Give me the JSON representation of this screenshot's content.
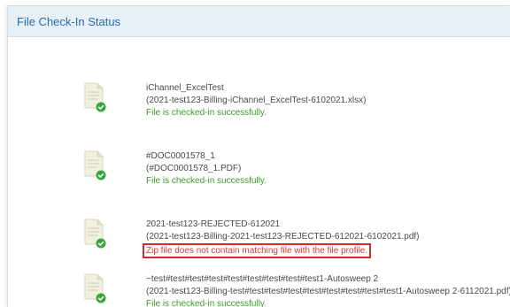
{
  "header": {
    "title": "File Check-In Status"
  },
  "colors": {
    "header_bg": "#e7f0f6",
    "title": "#2a6cab",
    "success": "#3a9a2a",
    "error": "#d63838",
    "highlight_border": "#d52b2b"
  },
  "files": [
    {
      "name": "iChannel_ExcelTest",
      "path": "(2021-test123-Billing-iChannel_ExcelTest-6102021.xlsx)",
      "status": "File is checked-in successfully.",
      "status_type": "success",
      "icon": "document-check-icon"
    },
    {
      "name": "#DOC0001578_1",
      "path": "(#DOC0001578_1.PDF)",
      "status": "File is checked-in successfully.",
      "status_type": "success",
      "icon": "document-check-icon"
    },
    {
      "name": "2021-test123-REJECTED-612021",
      "path": "(2021-test123-Billing-2021-test123-REJECTED-612021-6102021.pdf)",
      "status": "Zip file does not contain matching file with the file profile.",
      "status_type": "error",
      "icon": "document-check-icon"
    },
    {
      "name": "~test#test#test#test#test#test#test#test#test1-Autosweep 2",
      "path": "(2021-test123-Billing-test#test#test#test#test#test#test#test#test1-Autosweep 2-6112021.pdf)",
      "status": "File is checked-in successfully.",
      "status_type": "success",
      "icon": "document-check-icon"
    }
  ]
}
